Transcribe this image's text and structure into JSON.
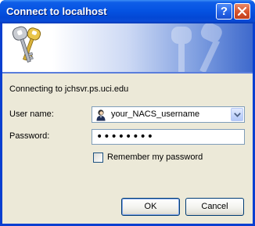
{
  "window": {
    "title": "Connect to localhost"
  },
  "titlebar": {
    "help_label": "?",
    "icons": [
      "help-icon",
      "close-icon"
    ]
  },
  "banner": {
    "icons": [
      "keys-icon"
    ]
  },
  "main": {
    "connecting_text": "Connecting to jchsvr.ps.uci.edu",
    "user_label": "User name:",
    "user_value": "your_NACS_username",
    "password_label": "Password:",
    "password_value": "••••••••",
    "remember_label": "Remember my password",
    "remember_checked": false
  },
  "buttons": {
    "ok_label": "OK",
    "cancel_label": "Cancel"
  },
  "colors": {
    "titlebar": "#0553e2",
    "client_background": "#ece9d8",
    "close_button": "#d7532c",
    "field_border": "#7f9db9"
  }
}
